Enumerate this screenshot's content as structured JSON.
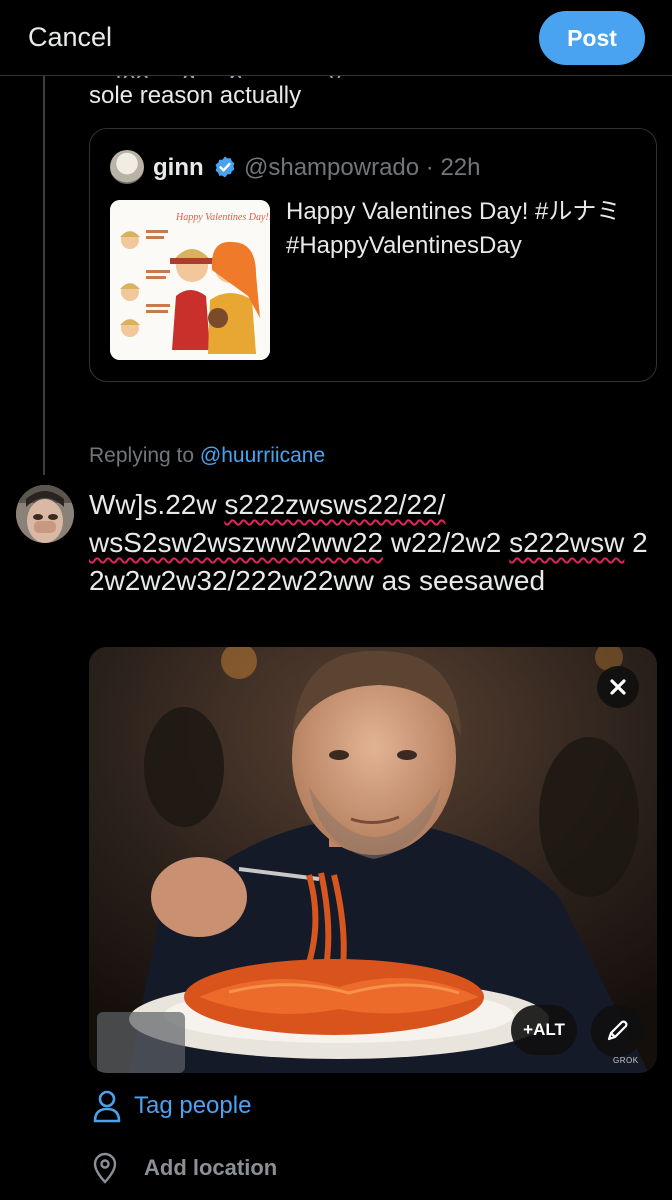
{
  "header": {
    "cancel_label": "Cancel",
    "post_label": "Post"
  },
  "previous_post": {
    "partial_line": "... too ... g ... p ... ... ... y ...",
    "last_line": "sole reason actually"
  },
  "quoted_post": {
    "author_name": "ginn",
    "handle_time": "@shampowrado · 22h",
    "text": "Happy Valentines Day! #ルナミ #HappyValentinesDay",
    "image_caption": "Happy Valentines Day!!"
  },
  "reply_context": {
    "prefix": "Replying to ",
    "handle": "@huurriicane"
  },
  "compose": {
    "segments": [
      {
        "text": "Ww]s.22w ",
        "misspelled": false
      },
      {
        "text": "s222zwsws22/22/",
        "misspelled": true
      },
      {
        "text": " ",
        "misspelled": false
      },
      {
        "text": "wsS2sw2wszww2ww22",
        "misspelled": true
      },
      {
        "text": " w22/2w2 ",
        "misspelled": false
      },
      {
        "text": "s222wsw",
        "misspelled": true
      },
      {
        "text": " 2 2w2w2w32/222w22ww as seesawed",
        "misspelled": false
      }
    ]
  },
  "media": {
    "alt_label": "+ALT",
    "watermark": "GROK"
  },
  "actions": {
    "tag_people_label": "Tag people",
    "add_location_label": "Add location"
  },
  "colors": {
    "accent": "#4aa3f0",
    "background": "#000000",
    "text": "#e7e9ea",
    "muted": "#71767b",
    "spellcheck": "#e0245e"
  },
  "icons": [
    "close-icon",
    "verified-badge-icon",
    "pencil-icon",
    "person-icon",
    "location-pin-icon"
  ]
}
